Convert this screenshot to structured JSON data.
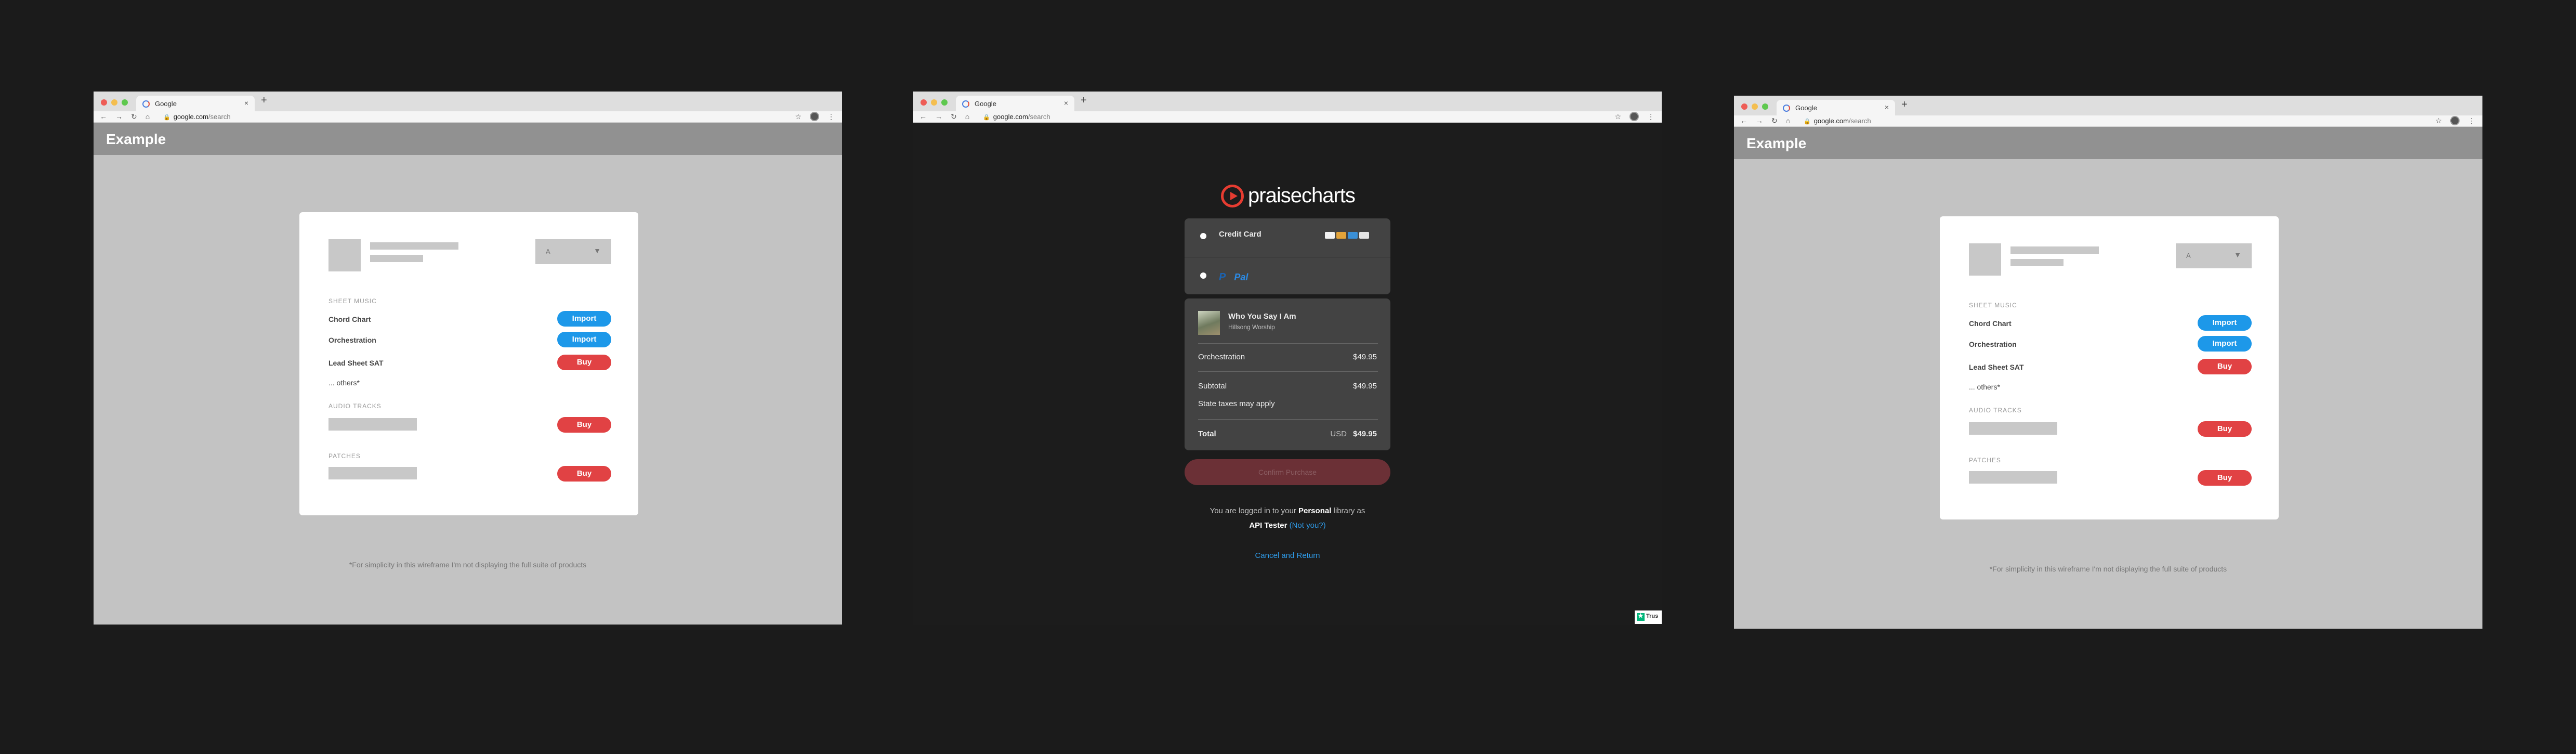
{
  "browser": {
    "tab_title": "Google",
    "tab_close": "×",
    "new_tab": "+",
    "url_host": "google.com",
    "url_path": "/search",
    "nav_icons": [
      "back-icon",
      "forward-icon",
      "reload-icon",
      "home-icon"
    ],
    "lock_icon": "🔒",
    "star_icon": "☆",
    "menu_icon": "⋮"
  },
  "wireframe": {
    "app_title": "Example",
    "dropdown_value": "A",
    "dropdown_chevron": "▼",
    "sheet_music_header": "SHEET MUSIC",
    "items": [
      {
        "label": "Chord Chart",
        "button": "Import"
      },
      {
        "label": "Orchestration",
        "button": "Import"
      },
      {
        "label": "Lead Sheet SAT",
        "button": "Buy"
      }
    ],
    "others_label": "... others*",
    "audio_tracks_header": "AUDIO TRACKS",
    "audio_button": "Buy",
    "patches_header": "PATCHES",
    "patches_button": "Buy",
    "footnote": "*For simplicity in this wireframe I'm not displaying the full suite of products"
  },
  "checkout": {
    "brand": "praisecharts",
    "payment_methods": {
      "credit_card": "Credit Card",
      "paypal": "Pal",
      "card_icons": [
        "visa-icon",
        "mastercard-icon",
        "amex-icon",
        "discover-icon"
      ]
    },
    "song": {
      "title": "Who You Say I Am",
      "artist": "Hillsong Worship"
    },
    "line_item": {
      "label": "Orchestration",
      "price": "$49.95"
    },
    "subtotal": {
      "label": "Subtotal",
      "value": "$49.95"
    },
    "tax_note": "State taxes may apply",
    "total": {
      "label": "Total",
      "currency": "USD",
      "value": "$49.95"
    },
    "confirm_button": "Confirm Purchase",
    "logged_in": {
      "prefix": "You are logged in to your",
      "library": "Personal",
      "suffix": "library as",
      "user": "API Tester",
      "not_you": "(Not you?)"
    },
    "cancel_link": "Cancel and Return",
    "trust_badge": "Trus"
  },
  "colors": {
    "import_blue": "#1d98e9",
    "buy_red": "#e14244",
    "brand_red": "#e63c31",
    "link_blue": "#2f9be8"
  }
}
